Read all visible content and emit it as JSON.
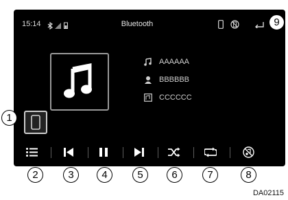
{
  "status": {
    "time": "15:14"
  },
  "header": {
    "title": "Bluetooth"
  },
  "track": {
    "title": "AAAAAA",
    "artist": "BBBBBB",
    "album": "CCCCCC"
  },
  "callouts": [
    "1",
    "2",
    "3",
    "4",
    "5",
    "6",
    "7",
    "8",
    "9"
  ],
  "figure_code": "DA02115",
  "colors": {
    "screen": "#000000",
    "text": "#d9d9d9",
    "separator": "#5e5e5e"
  }
}
